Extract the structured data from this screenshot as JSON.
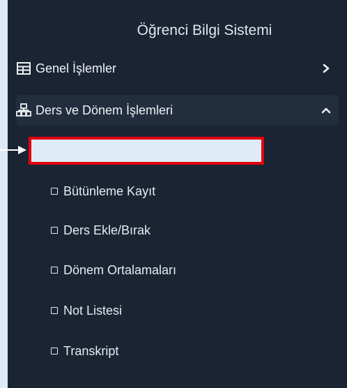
{
  "sidebar": {
    "title": "Öğrenci Bilgi Sistemi",
    "groups": [
      {
        "label": "Genel İşlemler",
        "icon": "list-icon",
        "state": "collapsed"
      },
      {
        "label": "Ders ve Dönem İşlemleri",
        "icon": "sitemap-icon",
        "state": "expanded"
      }
    ],
    "sub_items": [
      {
        "label": "Bütünleme Kayıt"
      },
      {
        "label": "Ders Ekle/Bırak"
      },
      {
        "label": "Dönem Ortalamaları"
      },
      {
        "label": "Not Listesi"
      },
      {
        "label": "Transkript"
      }
    ]
  },
  "colors": {
    "sidebar_bg": "#1b2432",
    "page_bg": "#dcebf5",
    "highlight_border": "#e3000f"
  }
}
